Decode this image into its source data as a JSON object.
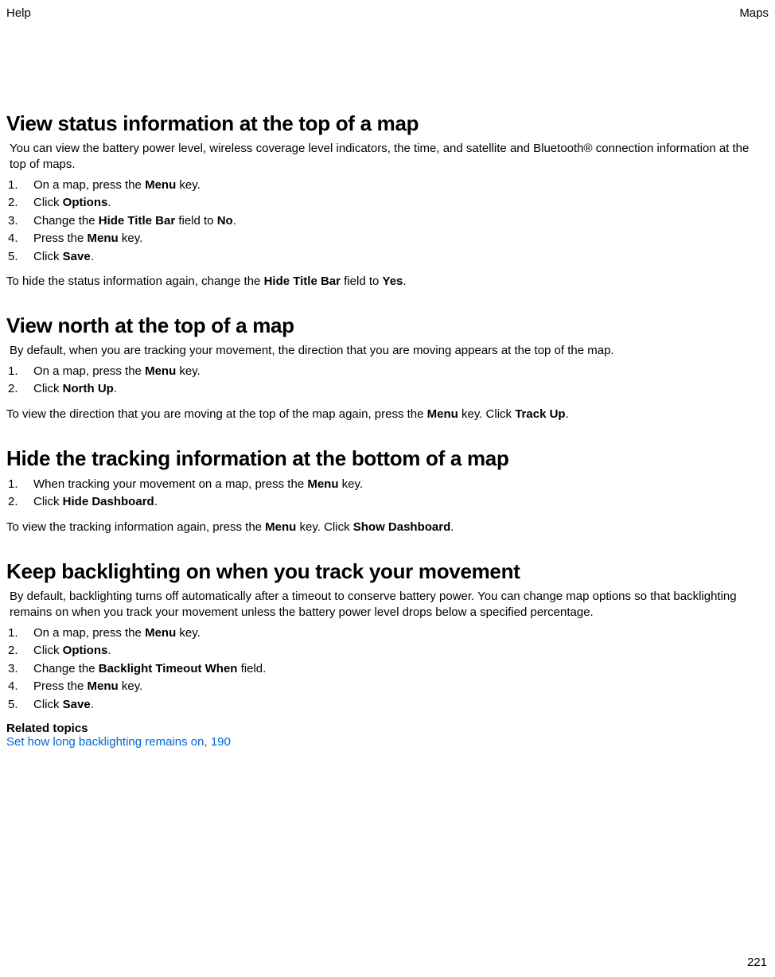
{
  "header": {
    "left": "Help",
    "right": "Maps"
  },
  "sections": {
    "s1": {
      "title": "View status information at the top of a map",
      "intro": "You can view the battery power level, wireless coverage level indicators, the time, and satellite and Bluetooth® connection information at the top of maps.",
      "step1_a": "On a map, press the ",
      "step1_b": "Menu",
      "step1_c": " key.",
      "step2_a": "Click ",
      "step2_b": "Options",
      "step2_c": ".",
      "step3_a": "Change the ",
      "step3_b": "Hide Title Bar",
      "step3_c": " field to ",
      "step3_d": "No",
      "step3_e": ".",
      "step4_a": "Press the ",
      "step4_b": "Menu",
      "step4_c": " key.",
      "step5_a": "Click ",
      "step5_b": "Save",
      "step5_c": ".",
      "note_a": "To hide the status information again, change the ",
      "note_b": "Hide Title Bar",
      "note_c": " field to ",
      "note_d": "Yes",
      "note_e": "."
    },
    "s2": {
      "title": "View north at the top of a map",
      "intro": "By default, when you are tracking your movement, the direction that you are moving appears at the top of the map.",
      "step1_a": "On a map, press the ",
      "step1_b": "Menu",
      "step1_c": " key.",
      "step2_a": "Click ",
      "step2_b": "North Up",
      "step2_c": ".",
      "note_a": "To view the direction that you are moving at the top of the map again, press the ",
      "note_b": "Menu",
      "note_c": " key. Click ",
      "note_d": "Track Up",
      "note_e": "."
    },
    "s3": {
      "title": "Hide the tracking information at the bottom of a map",
      "step1_a": "When tracking your movement on a map, press the ",
      "step1_b": "Menu",
      "step1_c": " key.",
      "step2_a": "Click ",
      "step2_b": "Hide Dashboard",
      "step2_c": ".",
      "note_a": "To view the tracking information again, press the ",
      "note_b": "Menu",
      "note_c": " key. Click ",
      "note_d": "Show Dashboard",
      "note_e": "."
    },
    "s4": {
      "title": "Keep backlighting on when you track your movement",
      "intro": "By default, backlighting turns off automatically after a timeout to conserve battery power. You can change map options so that backlighting remains on when you track your movement unless the battery power level drops below a specified percentage.",
      "step1_a": "On a map, press the ",
      "step1_b": "Menu",
      "step1_c": " key.",
      "step2_a": "Click ",
      "step2_b": "Options",
      "step2_c": ".",
      "step3_a": "Change the ",
      "step3_b": "Backlight Timeout When",
      "step3_c": " field.",
      "step4_a": "Press the ",
      "step4_b": "Menu",
      "step4_c": " key.",
      "step5_a": "Click ",
      "step5_b": "Save",
      "step5_c": ".",
      "related_label": "Related topics",
      "related_link": "Set how long backlighting remains on, 190"
    }
  },
  "footer": {
    "page_number": "221"
  }
}
